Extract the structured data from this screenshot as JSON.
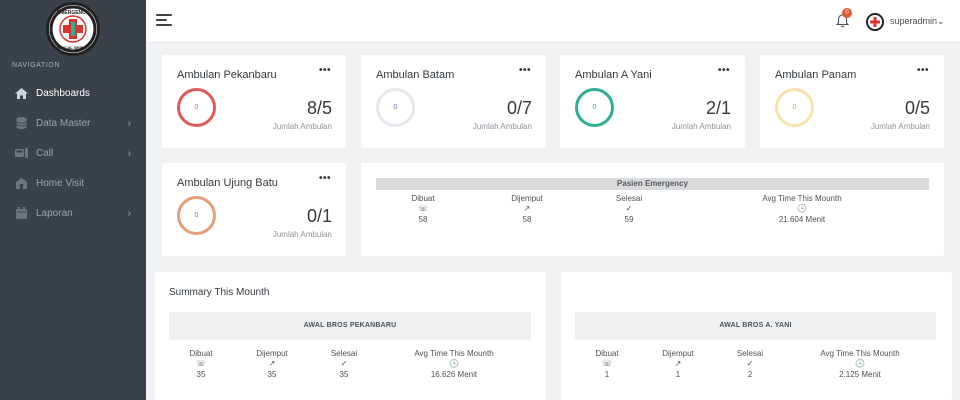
{
  "sidebar": {
    "logo_text": "EMERGENCY MEDICAL SERVICE",
    "heading": "NAVIGATION",
    "items": [
      {
        "label": "Dashboards",
        "icon": "home-icon",
        "active": true
      },
      {
        "label": "Data Master",
        "icon": "database-icon",
        "has_submenu": true
      },
      {
        "label": "Call",
        "icon": "call-icon",
        "has_submenu": true
      },
      {
        "label": "Home Visit",
        "icon": "home-visit-icon"
      },
      {
        "label": "Laporan",
        "icon": "calendar-icon",
        "has_submenu": true
      }
    ]
  },
  "topbar": {
    "notification_count": "0",
    "username": "superadmin",
    "username_caret": "⌄"
  },
  "ambulances": [
    {
      "title": "Ambulan Pekanbaru",
      "ring_value": "0",
      "count": "8/5",
      "sub": "Jumlah Ambulan",
      "color": "#e05a5a"
    },
    {
      "title": "Ambulan Batam",
      "ring_value": "0",
      "count": "0/7",
      "sub": "Jumlah Ambulan",
      "color": "#e6e8f0"
    },
    {
      "title": "Ambulan A Yani",
      "ring_value": "0",
      "count": "2/1",
      "sub": "Jumlah Ambulan",
      "color": "#2fae93"
    },
    {
      "title": "Ambulan Panam",
      "ring_value": "0",
      "count": "0/5",
      "sub": "Jumlah Ambulan",
      "color": "#f7e2b0"
    },
    {
      "title": "Ambulan Ujung Batu",
      "ring_value": "0",
      "count": "0/1",
      "sub": "Jumlah Ambulan",
      "color": "#e2a07a"
    }
  ],
  "card_menu": "•••",
  "pasien_emergency": {
    "title": "Pasien Emergency",
    "stats": [
      {
        "label": "Dibuat",
        "icon": "phone-icon",
        "value": "58"
      },
      {
        "label": "Dijemput",
        "icon": "arrow-up-right-icon",
        "value": "58"
      },
      {
        "label": "Selesai",
        "icon": "check-circle-icon",
        "value": "59"
      },
      {
        "label": "Avg Time This Mounth",
        "icon": "clock-icon",
        "value": "21.604 Menit"
      }
    ]
  },
  "summary": {
    "title": "Summary This Mounth",
    "branches": [
      {
        "name": "AWAL BROS PEKANBARU",
        "stats": [
          {
            "label": "Dibuat",
            "icon": "phone-icon",
            "value": "35"
          },
          {
            "label": "Dijemput",
            "icon": "arrow-up-right-icon",
            "value": "35"
          },
          {
            "label": "Selesai",
            "icon": "check-circle-icon",
            "value": "35"
          },
          {
            "label": "Avg Time This Mounth",
            "icon": "clock-icon",
            "value": "16.626 Menit"
          }
        ]
      },
      {
        "name": "AWAL BROS A. YANI",
        "stats": [
          {
            "label": "Dibuat",
            "icon": "phone-icon",
            "value": "1"
          },
          {
            "label": "Dijemput",
            "icon": "arrow-up-right-icon",
            "value": "1"
          },
          {
            "label": "Selesai",
            "icon": "check-circle-icon",
            "value": "2"
          },
          {
            "label": "Avg Time This Mounth",
            "icon": "clock-icon",
            "value": "2.125 Menit"
          }
        ]
      }
    ]
  }
}
